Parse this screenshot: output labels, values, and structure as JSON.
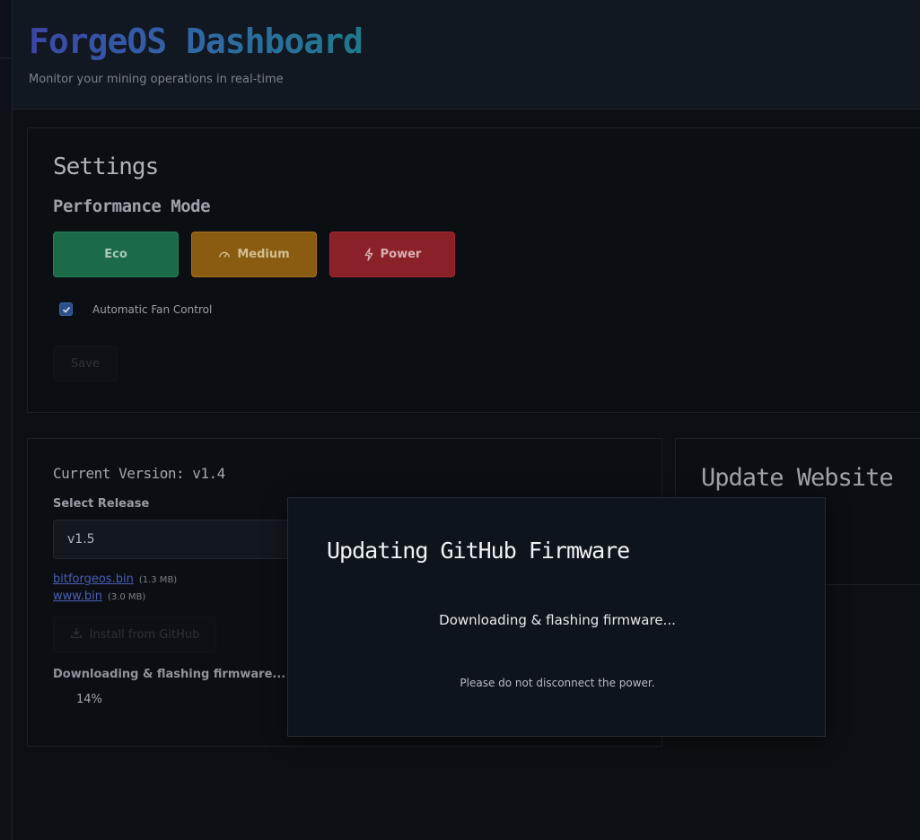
{
  "header": {
    "title": "ForgeOS Dashboard",
    "subtitle": "Monitor your mining operations in real-time"
  },
  "settings": {
    "title": "Settings",
    "performance_mode_title": "Performance Mode",
    "modes": [
      {
        "label": "Eco",
        "icon": "none"
      },
      {
        "label": "Medium",
        "icon": "gauge-icon"
      },
      {
        "label": "Power",
        "icon": "lightning-icon"
      }
    ],
    "auto_fan_label": "Automatic Fan Control",
    "auto_fan_checked": true,
    "save_label": "Save"
  },
  "firmware": {
    "current_version": "Current Version: v1.4",
    "select_label": "Select Release",
    "selected_release": "v1.5",
    "files": [
      {
        "name": "bitforgeos.bin",
        "size": "(1.3 MB)"
      },
      {
        "name": "www.bin",
        "size": "(3.0 MB)"
      }
    ],
    "install_label": "Install from GitHub",
    "progress_label": "Downloading & flashing firmware...",
    "progress_percent": "14%"
  },
  "website": {
    "title": "Update Website"
  },
  "modal": {
    "title": "Updating GitHub Firmware",
    "status": "Downloading & flashing firmware...",
    "warning": "Please do not disconnect the power."
  },
  "colors": {
    "eco": "#1b6a4a",
    "medium": "#8a5c12",
    "power": "#8b2128",
    "checkbox": "#2d4f8a",
    "link": "#4a5fb8"
  }
}
